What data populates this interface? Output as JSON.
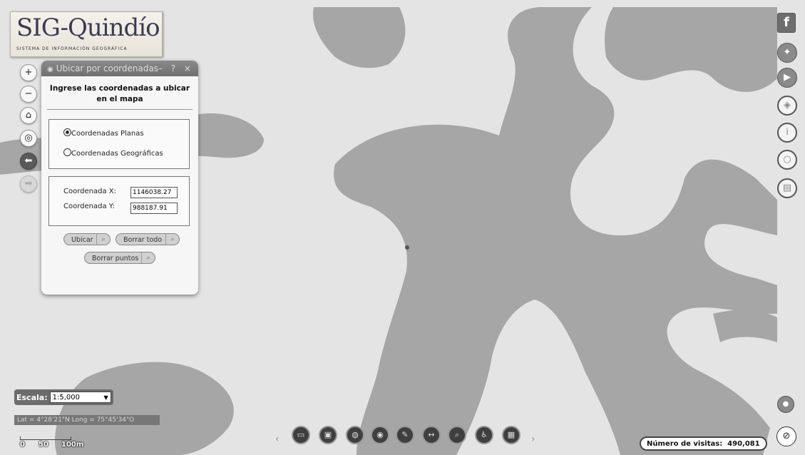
{
  "logo": {
    "title": "SIG-Quindío",
    "subtitle": "SISTEMA DE INFORMACIÓN GEOGRÁFICA"
  },
  "map_controls": [
    {
      "name": "zoom-in-button",
      "icon": "+"
    },
    {
      "name": "zoom-out-button",
      "icon": "−"
    },
    {
      "name": "home-button",
      "icon": "⌂"
    },
    {
      "name": "locate-button",
      "icon": "◎"
    },
    {
      "name": "back-button",
      "icon": "⬅"
    },
    {
      "name": "forward-button",
      "icon": "➡"
    }
  ],
  "panel": {
    "title": "Ubicar por coordenadas",
    "controls": "– ? ×",
    "instruction": "Ingrese las coordenadas a ubicar en el mapa",
    "radio_planas": "Coordenadas Planas",
    "radio_geograficas": "Coordenadas Geográficas",
    "label_x": "Coordenada X:",
    "label_y": "Coordenada Y:",
    "value_x": "1146038.27",
    "value_y": "988187.91",
    "btn_ubicar": "Ubicar",
    "btn_borrar_todo": "Borrar todo",
    "btn_borrar_puntos": "Borrar puntos"
  },
  "scale": {
    "label": "Escala:",
    "value": "1:5,000"
  },
  "coords_readout": "Lat = 4°28'21\"N Long = 75°45'34\"O",
  "scalebar": {
    "t0": "0",
    "t1": "50",
    "t2": "100m"
  },
  "visits": {
    "label": "Número de visitas:",
    "value": "490,081"
  },
  "social_icons": [
    "facebook-icon",
    "twitter-icon",
    "youtube-icon",
    "layers-icon",
    "info-icon",
    "circle-icon",
    "print-icon"
  ],
  "colors": {
    "map_bg": "#e4e4e4",
    "map_dark": "#a6a6a6",
    "panel_bg": "#f6f6f6",
    "header": "#7a7a7a"
  }
}
